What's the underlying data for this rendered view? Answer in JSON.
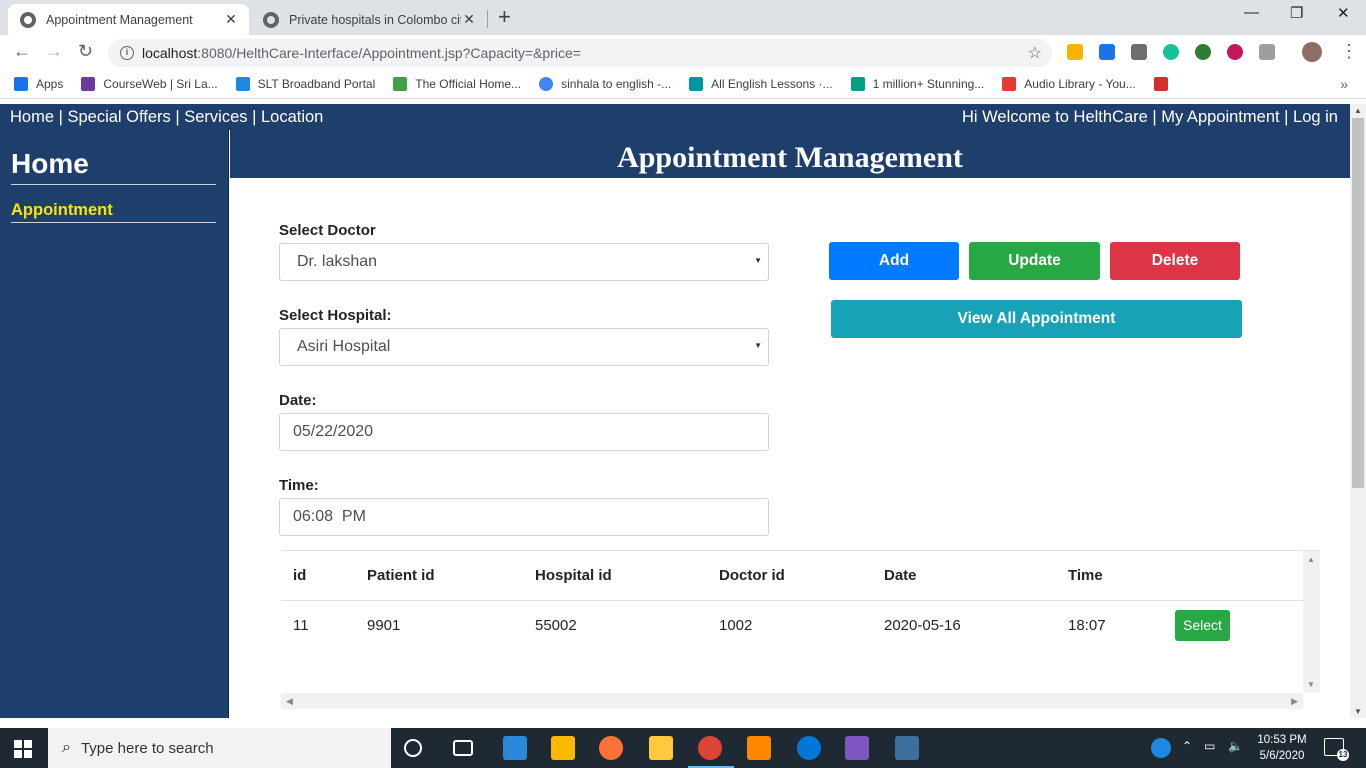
{
  "browser": {
    "tabs": [
      {
        "title": "Appointment Management",
        "close": "✕"
      },
      {
        "title": "Private hospitals in Colombo city",
        "close": "✕"
      }
    ],
    "new_tab": "+",
    "window_controls": {
      "minimize": "—",
      "restore": "❐",
      "close": "✕"
    },
    "url_host": "localhost",
    "url_path": ":8080/HelthCare-Interface/Appointment.jsp?Capacity=&price=",
    "bookmarks": [
      {
        "label": "Apps",
        "color": "#1a73e8"
      },
      {
        "label": "CourseWeb | Sri La...",
        "color": "#6a3d9a"
      },
      {
        "label": "SLT Broadband Portal",
        "color": "#1e88e5"
      },
      {
        "label": "The Official Home...",
        "color": "#43a047"
      },
      {
        "label": "sinhala to english -...",
        "color": "#4285f4"
      },
      {
        "label": "All English Lessons ·...",
        "color": "#0097a7"
      },
      {
        "label": "1 million+ Stunning...",
        "color": "#05a081"
      },
      {
        "label": "Audio Library - You...",
        "color": "#e53935"
      }
    ],
    "bookmarks_more": "»"
  },
  "page": {
    "topnav_left": "Home | Special Offers | Services | Location",
    "topnav_right": "Hi Welcome to HelthCare | My Appointment | Log in",
    "sidebar_title": "Home",
    "sidebar_item": "Appointment",
    "banner_title": "Appointment Management",
    "form": {
      "doctor_label": "Select Doctor",
      "doctor_value": "Dr. lakshan",
      "hospital_label": "Select Hospital:",
      "hospital_value": "Asiri Hospital",
      "date_label": "Date:",
      "date_value": "05/22/2020",
      "time_label": "Time:",
      "time_value": "06:08  PM"
    },
    "buttons": {
      "add": "Add",
      "update": "Update",
      "delete": "Delete",
      "view_all": "View All Appointment"
    },
    "table": {
      "headers": [
        "id",
        "Patient id",
        "Hospital id",
        "Doctor id",
        "Date",
        "Time"
      ],
      "rows": [
        {
          "id": "11",
          "patient": "9901",
          "hospital": "55002",
          "doctor": "1002",
          "date": "2020-05-16",
          "time": "18:07",
          "action": "Select"
        }
      ]
    }
  },
  "taskbar": {
    "search_placeholder": "Type here to search",
    "time": "10:53 PM",
    "date": "5/6/2020",
    "notifications": "13"
  },
  "colors": {
    "navy": "#1e3f6b",
    "sidebar_active": "#f5e414",
    "add": "#007bff",
    "update": "#28a745",
    "delete": "#dc3545",
    "view_all": "#17a2b8"
  }
}
